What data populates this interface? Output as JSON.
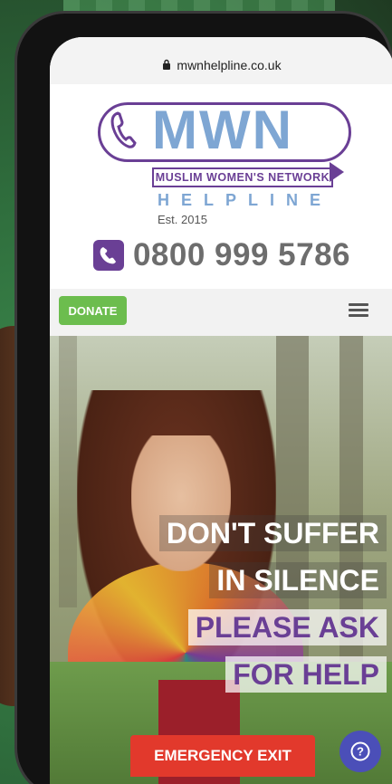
{
  "browser": {
    "url": "mwnhelpline.co.uk"
  },
  "logo": {
    "acronym": "MWN",
    "network": "MUSLIM WOMEN'S NETWORK",
    "helpline": "HELPLINE",
    "established": "Est. 2015"
  },
  "contact": {
    "phone": "0800 999 5786"
  },
  "nav": {
    "donate_label": "DONATE",
    "menu_icon": "hamburger-menu-icon"
  },
  "hero": {
    "lines": [
      "DON'T SUFFER",
      "IN SILENCE",
      "PLEASE ASK",
      "FOR HELP"
    ]
  },
  "actions": {
    "emergency_exit": "EMERGENCY EXIT",
    "help_icon": "question-mark-icon"
  },
  "colors": {
    "brand_purple": "#6a3f95",
    "brand_blue": "#7ea6d3",
    "donate_green": "#6cbd4e",
    "exit_red": "#e2392c",
    "help_blue": "#4b4fb8"
  }
}
